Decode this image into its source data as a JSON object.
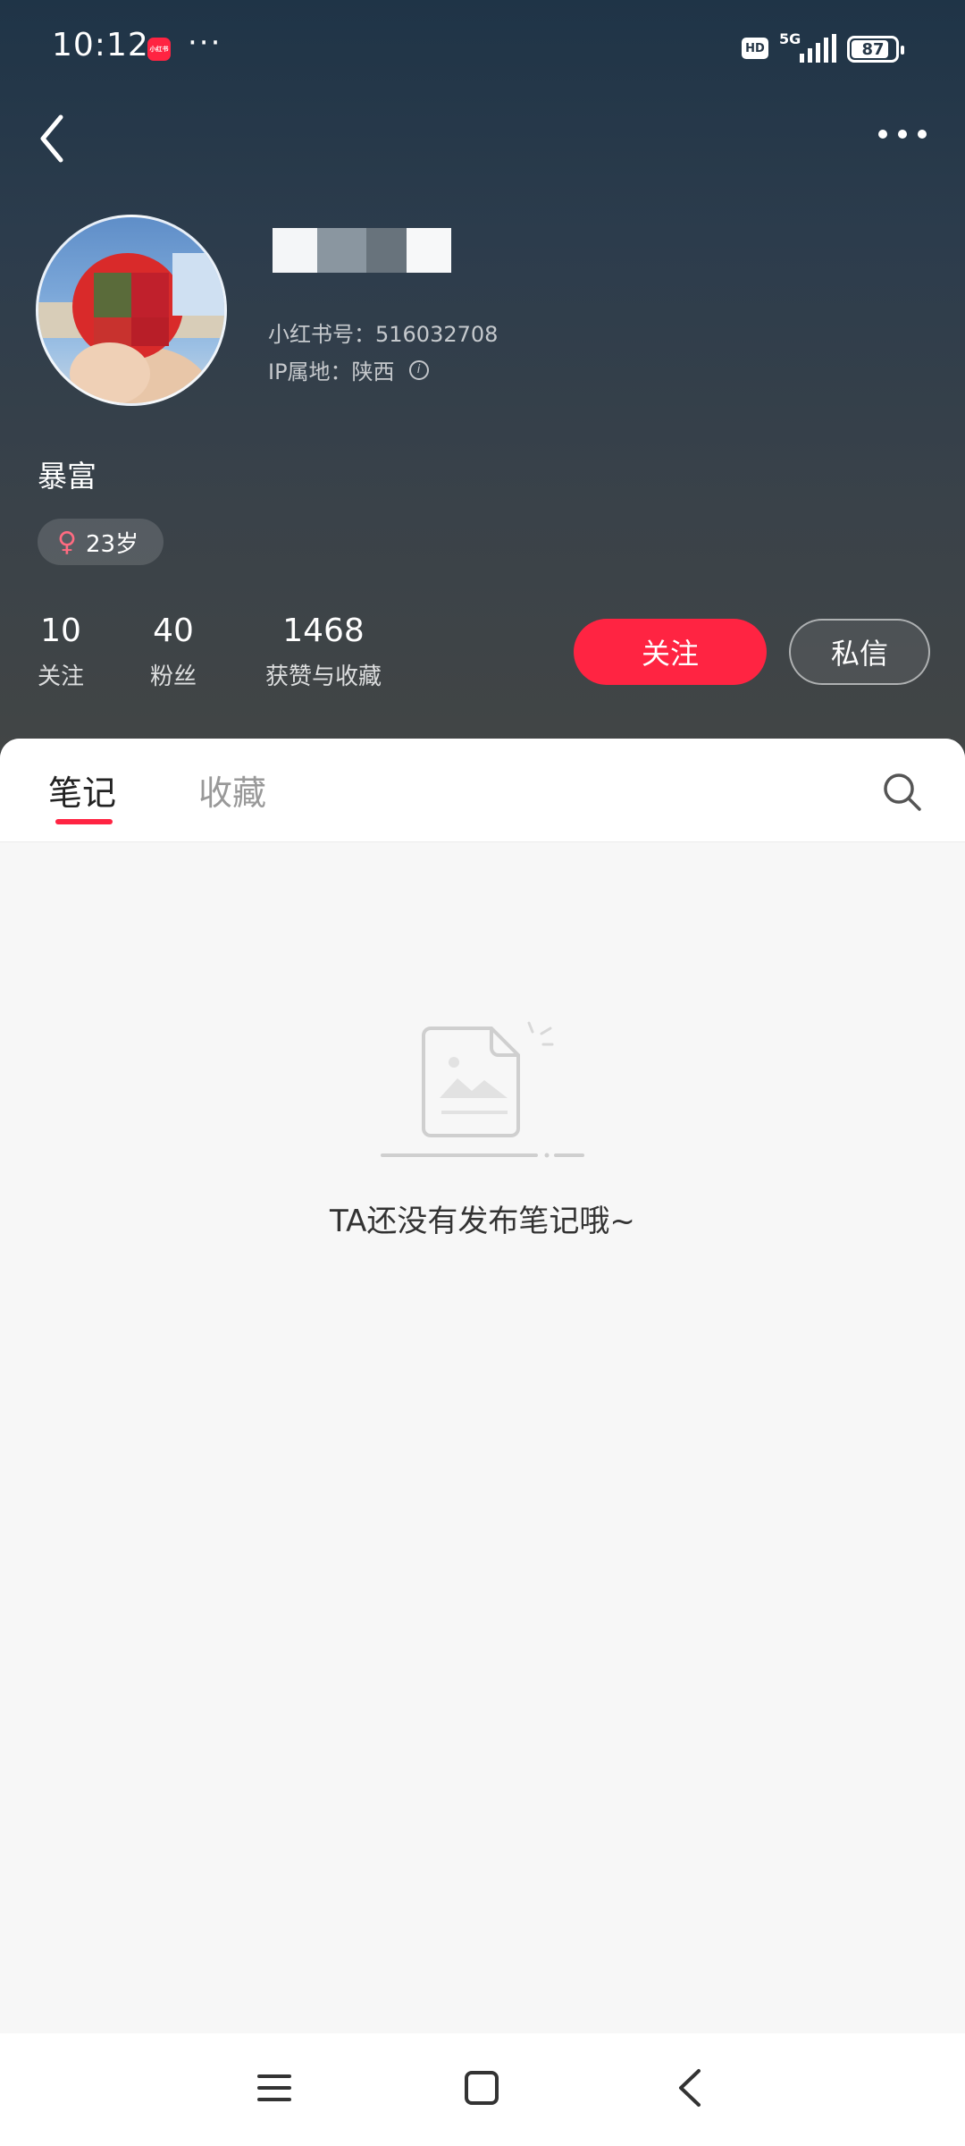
{
  "status_bar": {
    "time": "10:12",
    "app_icon_text": "小红书",
    "network": "5G",
    "hd": "HD",
    "battery": "87"
  },
  "profile": {
    "redbook_id": "小红书号：516032708",
    "ip_location": "IP属地：陕西",
    "bio": "暴富",
    "age": "23岁"
  },
  "stats": [
    {
      "value": "10",
      "label": "关注"
    },
    {
      "value": "40",
      "label": "粉丝"
    },
    {
      "value": "1468",
      "label": "获赞与收藏"
    }
  ],
  "actions": {
    "follow": "关注",
    "message": "私信"
  },
  "tabs": [
    {
      "label": "笔记",
      "active": true
    },
    {
      "label": "收藏",
      "active": false
    }
  ],
  "empty_state": {
    "text": "TA还没有发布笔记哦~"
  },
  "colors": {
    "accent": "#ff2442",
    "header_top": "#1f3447",
    "header_bottom": "#434645"
  },
  "icons": {
    "back": "chevron-left-icon",
    "more": "more-dots-icon",
    "search": "search-icon",
    "info": "info-icon",
    "female": "female-icon"
  }
}
